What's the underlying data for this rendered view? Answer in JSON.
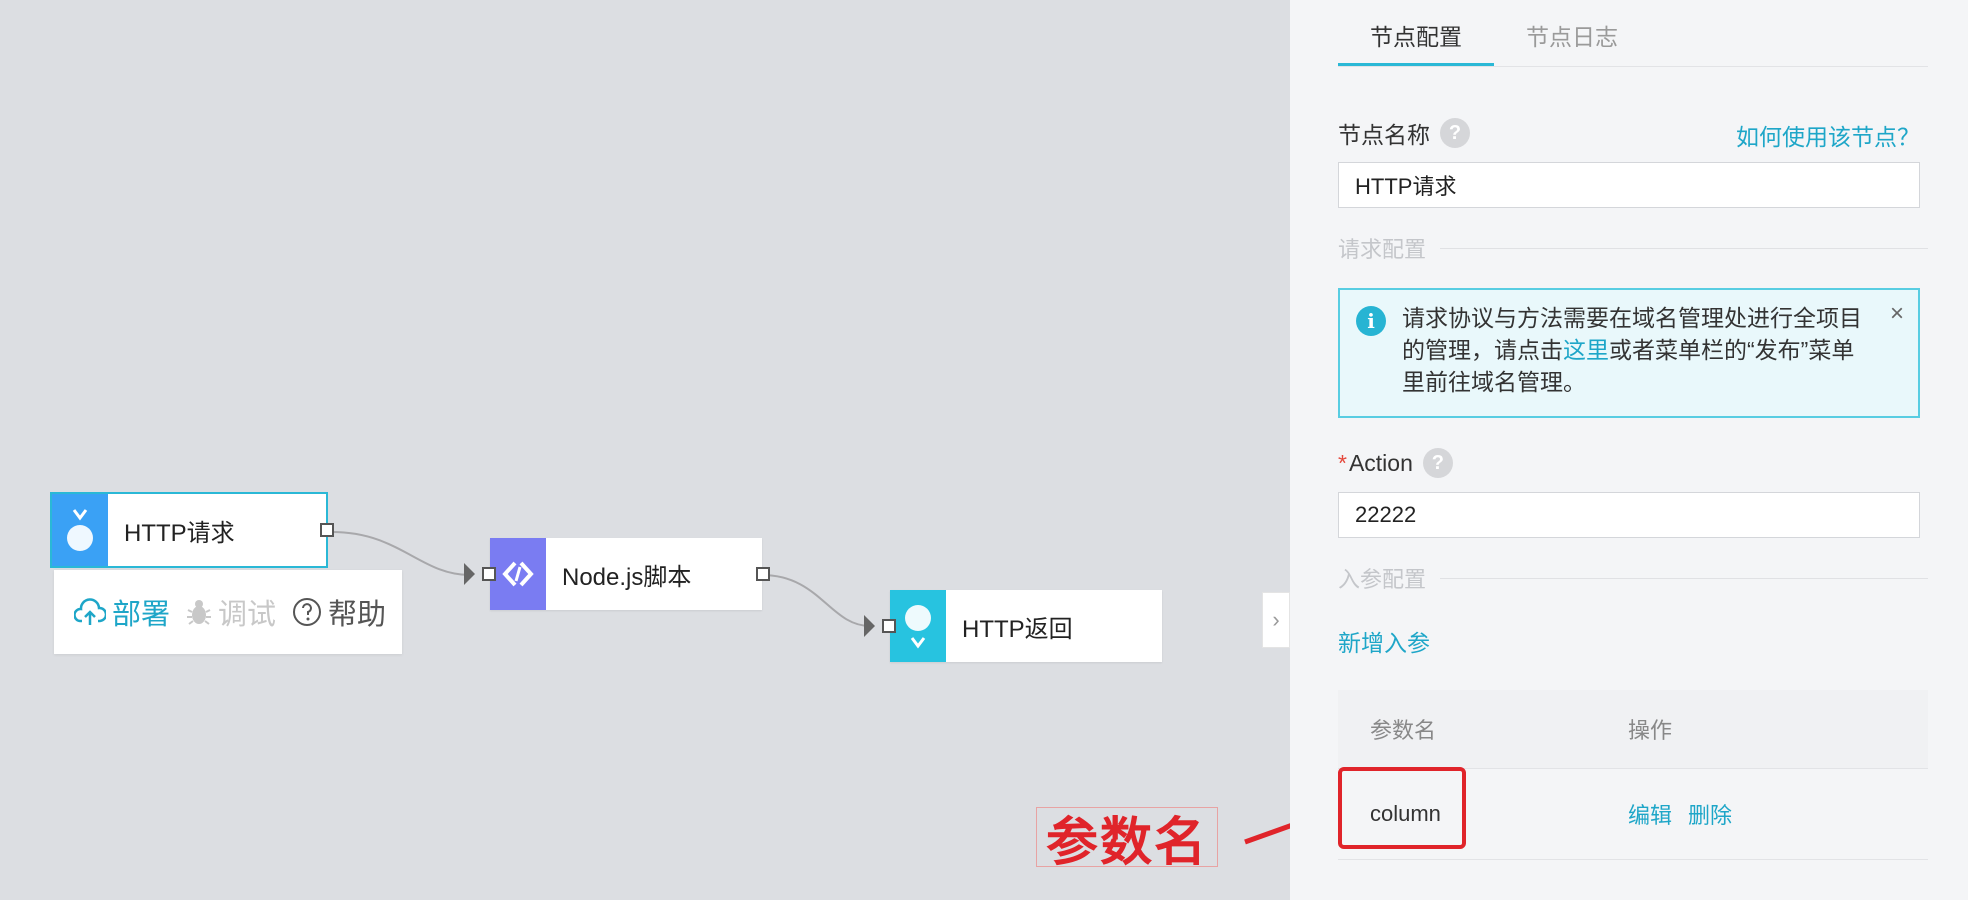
{
  "canvas": {
    "nodes": [
      {
        "label": "HTTP请求",
        "icon": "http-request-icon",
        "color": "#3aa1f5",
        "selected": true
      },
      {
        "label": "Node.js脚本",
        "icon": "code-icon",
        "color": "#7a7cf2"
      },
      {
        "label": "HTTP返回",
        "icon": "http-response-icon",
        "color": "#27c3e0"
      }
    ],
    "toolbar": {
      "deploy_label": "部署",
      "debug_label": "调试",
      "help_label": "帮助"
    },
    "annotation_text": "参数名",
    "collapse_icon": "›"
  },
  "panel": {
    "tabs": [
      {
        "label": "节点配置",
        "active": true
      },
      {
        "label": "节点日志",
        "active": false
      }
    ],
    "node_name_label": "节点名称",
    "howto_link": "如何使用该节点？",
    "node_name_value": "HTTP请求",
    "request_section": "请求配置",
    "alert": {
      "text_before": "请求协议与方法需要在域名管理处进行全项目的管理，请点击",
      "link": "这里",
      "text_after": "或者菜单栏的“发布”菜单里前往域名管理。",
      "close": "×"
    },
    "action_label": "Action",
    "action_required": "*",
    "action_value": "22222",
    "params_section": "入参配置",
    "add_param": "新增入参",
    "table": {
      "headers": [
        "参数名",
        "操作"
      ],
      "rows": [
        {
          "name": "column",
          "edit": "编辑",
          "delete": "删除"
        }
      ]
    },
    "help_mark": "?"
  },
  "colors": {
    "accent": "#1ea6c8",
    "annotation_red": "#e0242a"
  }
}
